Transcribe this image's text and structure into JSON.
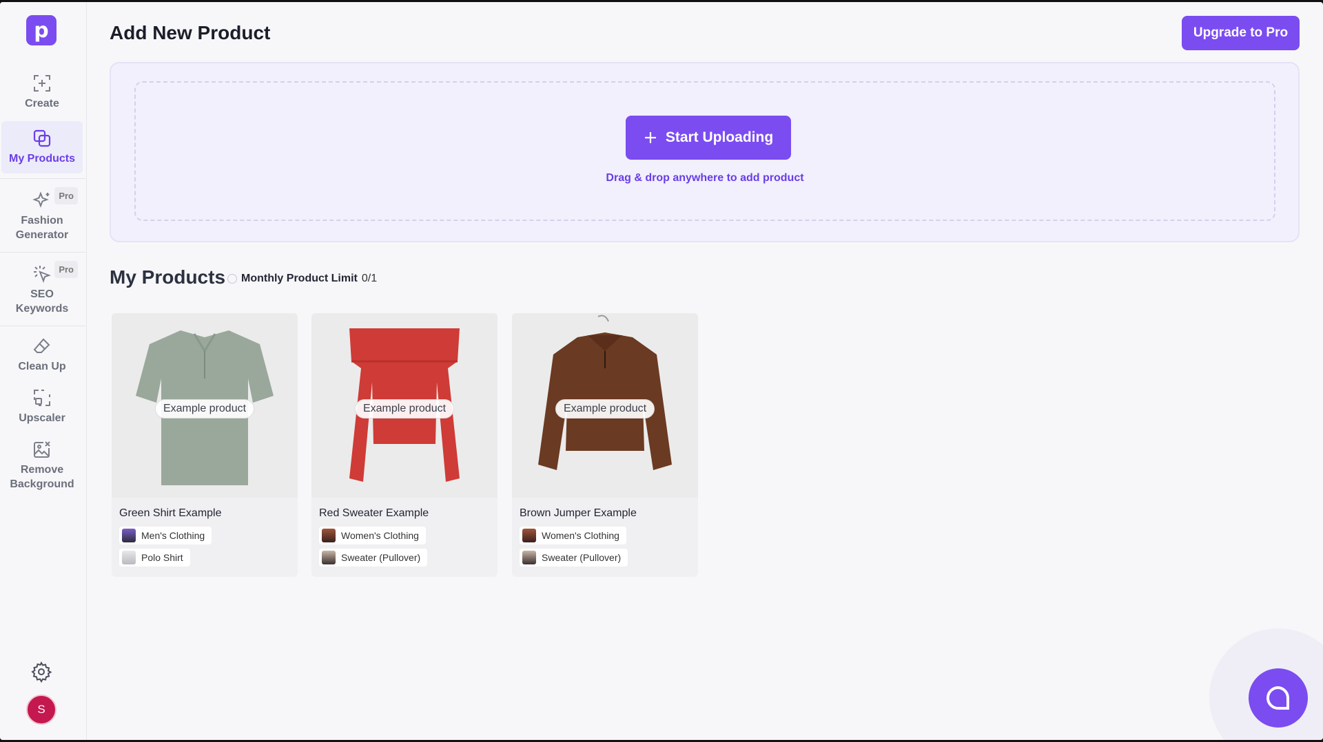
{
  "app": {
    "logo_letter": "p"
  },
  "sidebar": {
    "items": [
      {
        "label": "Create",
        "icon": "create-icon"
      },
      {
        "label": "My Products",
        "icon": "products-icon",
        "active": true
      },
      {
        "label": "Fashion Generator",
        "icon": "sparkle-icon",
        "tag": "Pro"
      },
      {
        "label": "SEO Keywords",
        "icon": "cursor-icon",
        "tag": "Pro"
      },
      {
        "label": "Clean Up",
        "icon": "eraser-icon"
      },
      {
        "label": "Upscaler",
        "icon": "upscale-icon"
      },
      {
        "label": "Remove Background",
        "icon": "remove-bg-icon"
      }
    ],
    "user_initial": "S"
  },
  "header": {
    "title": "Add New Product",
    "upgrade_label": "Upgrade to Pro"
  },
  "upload": {
    "button_label": "Start Uploading",
    "hint": "Drag & drop anywhere to add product"
  },
  "products": {
    "title": "My Products",
    "limit_label": "Monthly Product Limit",
    "limit_value": "0/1",
    "items": [
      {
        "name": "Green Shirt Example",
        "badge": "Example product",
        "tags": [
          "Men's Clothing",
          "Polo Shirt"
        ],
        "color": "#9aa89c"
      },
      {
        "name": "Red Sweater Example",
        "badge": "Example product",
        "tags": [
          "Women's Clothing",
          "Sweater (Pullover)"
        ],
        "color": "#cf3b36"
      },
      {
        "name": "Brown Jumper Example",
        "badge": "Example product",
        "tags": [
          "Women's Clothing",
          "Sweater (Pullover)"
        ],
        "color": "#6b3a22"
      }
    ]
  },
  "colors": {
    "accent": "#7b4cf0",
    "avatar": "#c4184f"
  }
}
